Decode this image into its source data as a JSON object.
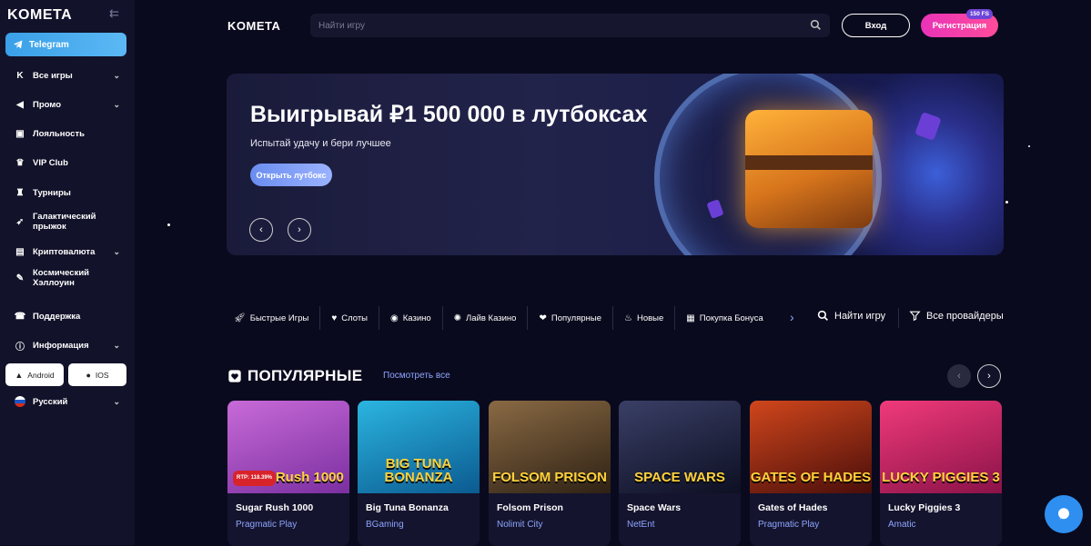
{
  "sidebar": {
    "logo": "KOMETA",
    "telegram_label": "Telegram",
    "items": [
      {
        "label": "Все игры",
        "icon": "kometa-k-icon",
        "has_chevron": true
      },
      {
        "label": "Промо",
        "icon": "megaphone-icon",
        "has_chevron": true
      },
      {
        "label": "Лояльность",
        "icon": "loyalty-icon",
        "has_chevron": false
      },
      {
        "label": "VIP Club",
        "icon": "crown-icon",
        "has_chevron": false
      },
      {
        "label": "Турниры",
        "icon": "trophy-icon",
        "has_chevron": false
      },
      {
        "label": "Галактический прыжок",
        "icon": "rocket-icon",
        "has_chevron": false
      },
      {
        "label": "Криптовалюта",
        "icon": "crypto-icon",
        "has_chevron": true
      },
      {
        "label": "Космический Хэллоуин",
        "icon": "wand-icon",
        "has_chevron": false
      },
      {
        "label": "Поддержка",
        "icon": "support-icon",
        "has_chevron": false
      },
      {
        "label": "Информация",
        "icon": "info-icon",
        "has_chevron": true
      }
    ],
    "android_label": "Android",
    "ios_label": "IOS",
    "language": "Русский"
  },
  "header": {
    "logo": "KOMETA",
    "search_placeholder": "Найти игру",
    "login_label": "Вход",
    "register_label": "Регистрация",
    "fs_badge": "150 FS"
  },
  "banner": {
    "title": "Выигрывай ₽1 500 000 в лутбоксах",
    "subtitle": "Испытай удачу и бери лучшее",
    "cta": "Открыть лутбокс"
  },
  "categories": [
    {
      "label": "Быстрые Игры",
      "icon": "rocket-icon"
    },
    {
      "label": "Слоты",
      "icon": "heart-icon"
    },
    {
      "label": "Казино",
      "icon": "poker-chip-icon"
    },
    {
      "label": "Лайв Казино",
      "icon": "live-icon"
    },
    {
      "label": "Популярные",
      "icon": "heart-badge-icon"
    },
    {
      "label": "Новые",
      "icon": "fire-icon"
    },
    {
      "label": "Покупка Бонуса",
      "icon": "gift-icon"
    }
  ],
  "find_game_label": "Найти игру",
  "all_providers_label": "Все провайдеры",
  "popular": {
    "title": "ПОПУЛЯРНЫЕ",
    "see_all": "Посмотреть все",
    "games": [
      {
        "name": "Sugar Rush 1000",
        "provider": "Pragmatic Play",
        "art": "Sugar Rush 1000",
        "rtp": "RTP: 118.39%",
        "color1": "#c86ad8",
        "color2": "#7b2fa0"
      },
      {
        "name": "Big Tuna Bonanza",
        "provider": "BGaming",
        "art": "BIG TUNA BONANZA",
        "rtp": "",
        "color1": "#2bb5e0",
        "color2": "#0b5a90"
      },
      {
        "name": "Folsom Prison",
        "provider": "Nolimit City",
        "art": "FOLSOM PRISON",
        "rtp": "",
        "color1": "#8a6a44",
        "color2": "#2e2114"
      },
      {
        "name": "Space Wars",
        "provider": "NetEnt",
        "art": "SPACE WARS",
        "rtp": "",
        "color1": "#3a3f66",
        "color2": "#0d0f22"
      },
      {
        "name": "Gates of Hades",
        "provider": "Pragmatic Play",
        "art": "GATES OF HADES",
        "rtp": "",
        "color1": "#d0461c",
        "color2": "#4a0e0a"
      },
      {
        "name": "Lucky Piggies 3",
        "provider": "Amatic",
        "art": "LUCKY PIGGIES 3",
        "rtp": "",
        "color1": "#f03a7a",
        "color2": "#8a1248"
      }
    ]
  }
}
